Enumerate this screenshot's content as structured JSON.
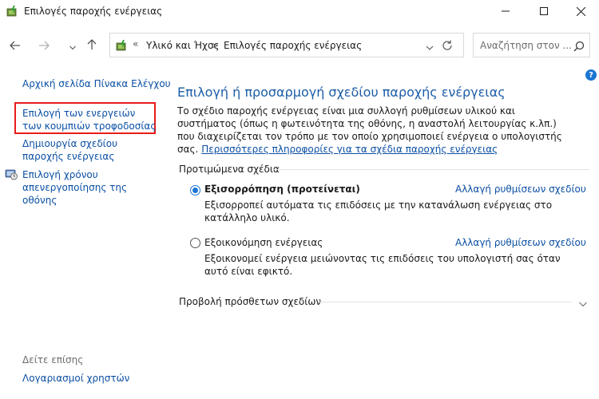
{
  "window": {
    "title": "Επιλογές παροχής ενέργειας"
  },
  "nav": {
    "breadcrumb_chevron": "«",
    "breadcrumbs": [
      "Υλικό και Ήχος",
      "Επιλογές παροχής ενέργειας"
    ],
    "breadcrumb_separator": ">",
    "search_placeholder": "Αναζήτηση στον ..."
  },
  "help": {
    "label": "?"
  },
  "sidebar": {
    "home": "Αρχική σελίδα Πίνακα Ελέγχου",
    "power_buttons": "Επιλογή των ενεργειών των κουμπιών τροφοδοσίας",
    "create_plan": "Δημιουργία σχεδίου παροχής ενέργειας",
    "display_off": "Επιλογή χρόνου απενεργοποίησης της οθόνης",
    "see_also": "Δείτε επίσης",
    "user_accounts": "Λογαριασμοί χρηστών"
  },
  "main": {
    "title": "Επιλογή ή προσαρμογή σχεδίου παροχής ενέργειας",
    "description": "Το σχέδιο παροχής ενέργειας είναι μια συλλογή ρυθμίσεων υλικού και συστήματος (όπως η φωτεινότητα της οθόνης, η αναστολή λειτουργίας κ.λπ.) που διαχειρίζεται τον τρόπο με τον οποίο χρησιμοποιεί ενέργεια ο υπολογιστής σας.",
    "more_info_link": "Περισσότερες πληροφορίες για τα σχέδια παροχής ενέργειας",
    "preferred_label": "Προτιμώμενα σχέδια",
    "plans": [
      {
        "name": "Εξισορρόπηση (προτείνεται)",
        "selected": true,
        "change": "Αλλαγή ρυθμίσεων σχεδίου",
        "description": "Εξισορροπεί αυτόματα τις επιδόσεις με την κατανάλωση ενέργειας στο κατάλληλο υλικό."
      },
      {
        "name": "Εξοικονόμηση ενέργειας",
        "selected": false,
        "change": "Αλλαγή ρυθμίσεων σχεδίου",
        "description": "Εξοικονομεί ενέργεια μειώνοντας τις επιδόσεις του υπολογιστή σας όταν αυτό είναι εφικτό."
      }
    ],
    "show_more_label": "Προβολή πρόσθετων σχεδίων"
  },
  "colors": {
    "link": "#0b4fa3",
    "title": "#1d5ea8",
    "highlight_box": "#e81b1b",
    "accent": "#1a75d2"
  }
}
